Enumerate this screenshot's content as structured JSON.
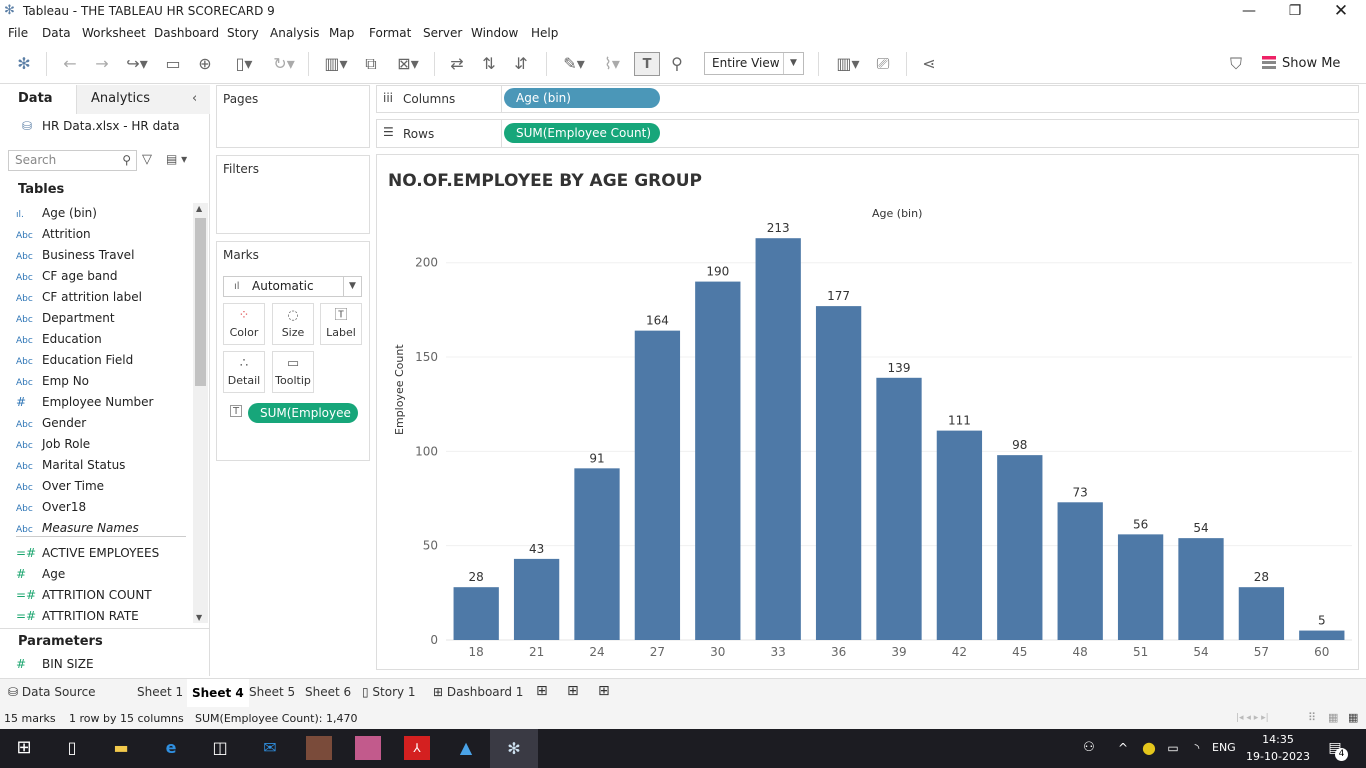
{
  "window": {
    "title": "Tableau - THE TABLEAU HR SCORECARD 9"
  },
  "menu": [
    "File",
    "Data",
    "Worksheet",
    "Dashboard",
    "Story",
    "Analysis",
    "Map",
    "Format",
    "Server",
    "Window",
    "Help"
  ],
  "toolbar": {
    "view_select": "Entire View",
    "show_me": "Show Me"
  },
  "datapane": {
    "tab_data": "Data",
    "tab_analytics": "Analytics",
    "datasource": "HR Data.xlsx - HR data",
    "search_placeholder": "Search",
    "tables_header": "Tables",
    "fields": [
      {
        "type": "bin",
        "name": "Age (bin)"
      },
      {
        "type": "Abc",
        "name": "Attrition"
      },
      {
        "type": "Abc",
        "name": "Business Travel"
      },
      {
        "type": "Abc",
        "name": "CF age band"
      },
      {
        "type": "Abc",
        "name": "CF attrition label"
      },
      {
        "type": "Abc",
        "name": "Department"
      },
      {
        "type": "Abc",
        "name": "Education"
      },
      {
        "type": "Abc",
        "name": "Education Field"
      },
      {
        "type": "Abc",
        "name": "Emp No"
      },
      {
        "type": "#",
        "name": "Employee Number"
      },
      {
        "type": "Abc",
        "name": "Gender"
      },
      {
        "type": "Abc",
        "name": "Job Role"
      },
      {
        "type": "Abc",
        "name": "Marital Status"
      },
      {
        "type": "Abc",
        "name": "Over Time"
      },
      {
        "type": "Abc",
        "name": "Over18"
      },
      {
        "type": "Abc",
        "name": "Measure Names"
      }
    ],
    "measures": [
      {
        "type": "=#",
        "name": "ACTIVE EMPLOYEES"
      },
      {
        "type": "#",
        "name": "Age"
      },
      {
        "type": "=#",
        "name": "ATTRITION COUNT"
      },
      {
        "type": "=#",
        "name": "ATTRITION RATE"
      }
    ],
    "parameters_header": "Parameters",
    "parameters": [
      {
        "type": "#",
        "name": "BIN SIZE"
      }
    ]
  },
  "shelves": {
    "pages": "Pages",
    "filters": "Filters",
    "marks": "Marks",
    "mark_type": "Automatic",
    "mark_buttons": [
      "Color",
      "Size",
      "Label",
      "Detail",
      "Tooltip"
    ],
    "mark_pill": "SUM(Employee ..",
    "columns_label": "Columns",
    "columns_pill": "Age (bin)",
    "rows_label": "Rows",
    "rows_pill": "SUM(Employee Count)"
  },
  "chart_data": {
    "type": "bar",
    "title": "NO.OF.EMPLOYEE BY AGE GROUP",
    "xlabel": "Age (bin)",
    "ylabel": "Employee Count",
    "categories": [
      "18",
      "21",
      "24",
      "27",
      "30",
      "33",
      "36",
      "39",
      "42",
      "45",
      "48",
      "51",
      "54",
      "57",
      "60"
    ],
    "values": [
      28,
      43,
      91,
      164,
      190,
      213,
      177,
      139,
      111,
      98,
      73,
      56,
      54,
      28,
      5
    ],
    "yticks": [
      0,
      50,
      100,
      150,
      200
    ],
    "ylim": [
      0,
      220
    ],
    "bar_color": "#4e79a7",
    "data_labels": true,
    "grid": true
  },
  "sheet_tabs": [
    "Data Source",
    "Sheet 1",
    "Sheet 4",
    "Sheet 5",
    "Sheet 6",
    "Story 1",
    "Dashboard 1"
  ],
  "active_sheet": "Sheet 4",
  "status": {
    "marks": "15 marks",
    "dims": "1 row by 15 columns",
    "sum": "SUM(Employee Count): 1,470"
  },
  "taskbar": {
    "time": "14:35",
    "date": "19-10-2023",
    "lang": "ENG",
    "notif": "4"
  }
}
